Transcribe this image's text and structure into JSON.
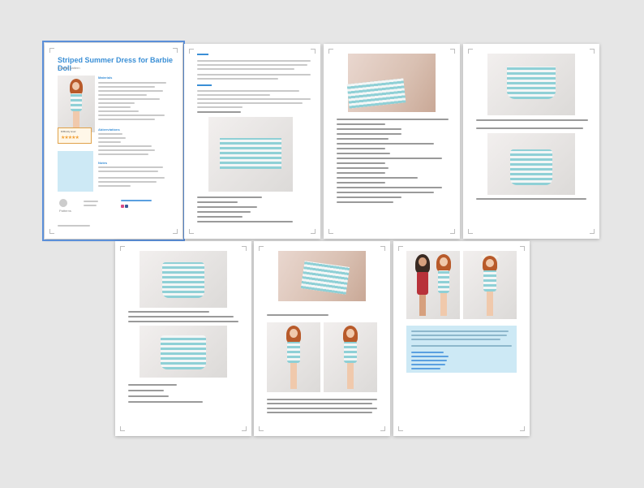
{
  "document": {
    "title": "Striped Summer Dress for Barbie Doll",
    "subtitle": "Crochet pattern",
    "sections": [
      "Materials",
      "Abbreviations",
      "Notes"
    ],
    "rating_label": "Difficulty level",
    "stars": "★★★★★",
    "brand": "Patterns",
    "pages": [
      {
        "id": 1,
        "selected": true
      },
      {
        "id": 2,
        "selected": false
      },
      {
        "id": 3,
        "selected": false
      },
      {
        "id": 4,
        "selected": false
      },
      {
        "id": 5,
        "selected": false
      },
      {
        "id": 6,
        "selected": false
      },
      {
        "id": 7,
        "selected": false
      }
    ]
  },
  "colors": {
    "accent": "#3a8fd6",
    "stripe_blue": "#8fd0d6",
    "info_box": "#cde9f5",
    "selection": "#5b8fd9"
  },
  "icons": [
    "crop-mark-icon",
    "instagram-icon",
    "facebook-icon",
    "logo-icon"
  ]
}
